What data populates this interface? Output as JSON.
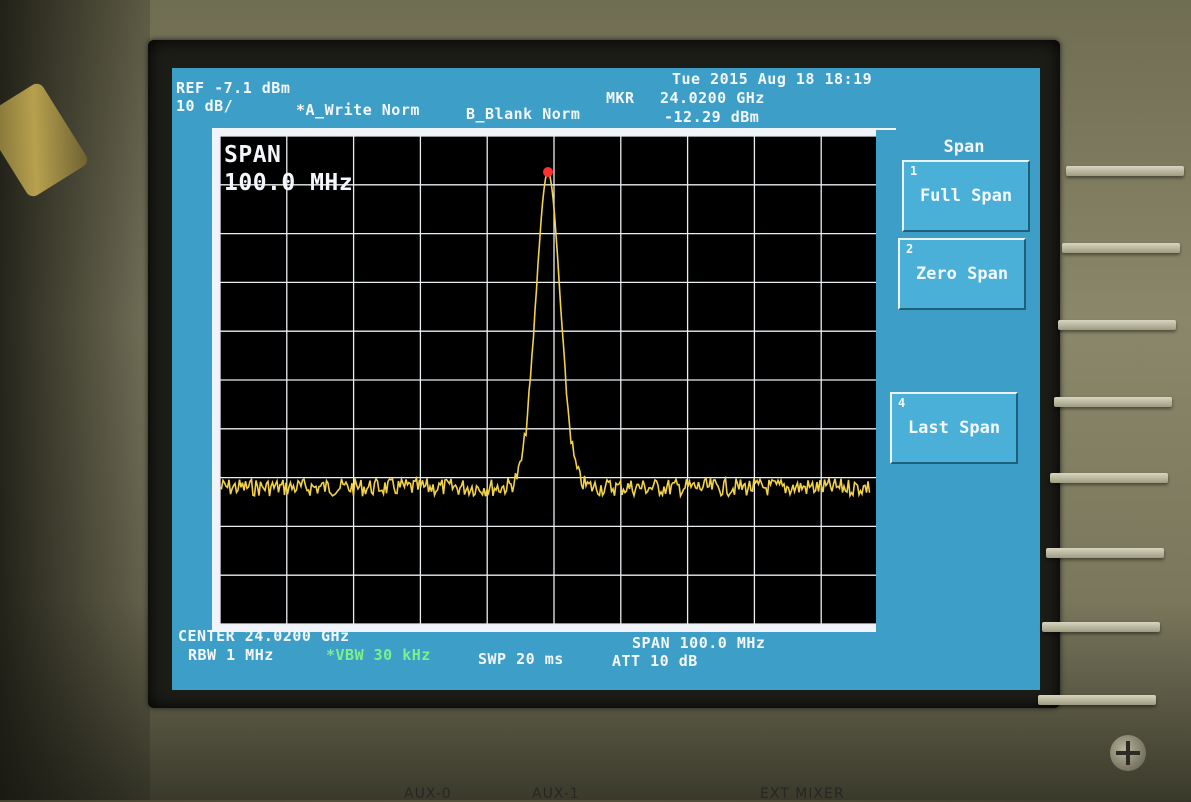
{
  "header": {
    "ref_level": "REF -7.1 dBm",
    "scale": "10 dB/",
    "trace_a": "*A_Write Norm",
    "trace_b": "B_Blank Norm",
    "datetime": "Tue 2015 Aug 18 18:19",
    "marker_label": "MKR",
    "marker_freq": "24.0200 GHz",
    "marker_level": "-12.29 dBm"
  },
  "plot": {
    "span_title": "SPAN",
    "span_value": "100.0 MHz",
    "trace_color": "#f2d247",
    "marker_color": "#ff3030",
    "grid_color": "#e9eef2"
  },
  "footer": {
    "center": "CENTER 24.0200 GHz",
    "rbw": "RBW 1 MHz",
    "vbw": "*VBW 30 kHz",
    "swp": "SWP 20 ms",
    "span": "SPAN 100.0 MHz",
    "att": "ATT 10 dB"
  },
  "softkeys": {
    "title": "Span",
    "items": [
      {
        "num": "1",
        "label": "Full Span"
      },
      {
        "num": "2",
        "label": "Zero Span"
      },
      {
        "num": "4",
        "label": "Last Span"
      }
    ]
  },
  "panel": {
    "labels": [
      "AUX-0",
      "AUX-1",
      "EXT MIXER"
    ]
  },
  "colors": {
    "screen_bg": "#3d9fc8",
    "plot_bg": "#000000"
  }
}
